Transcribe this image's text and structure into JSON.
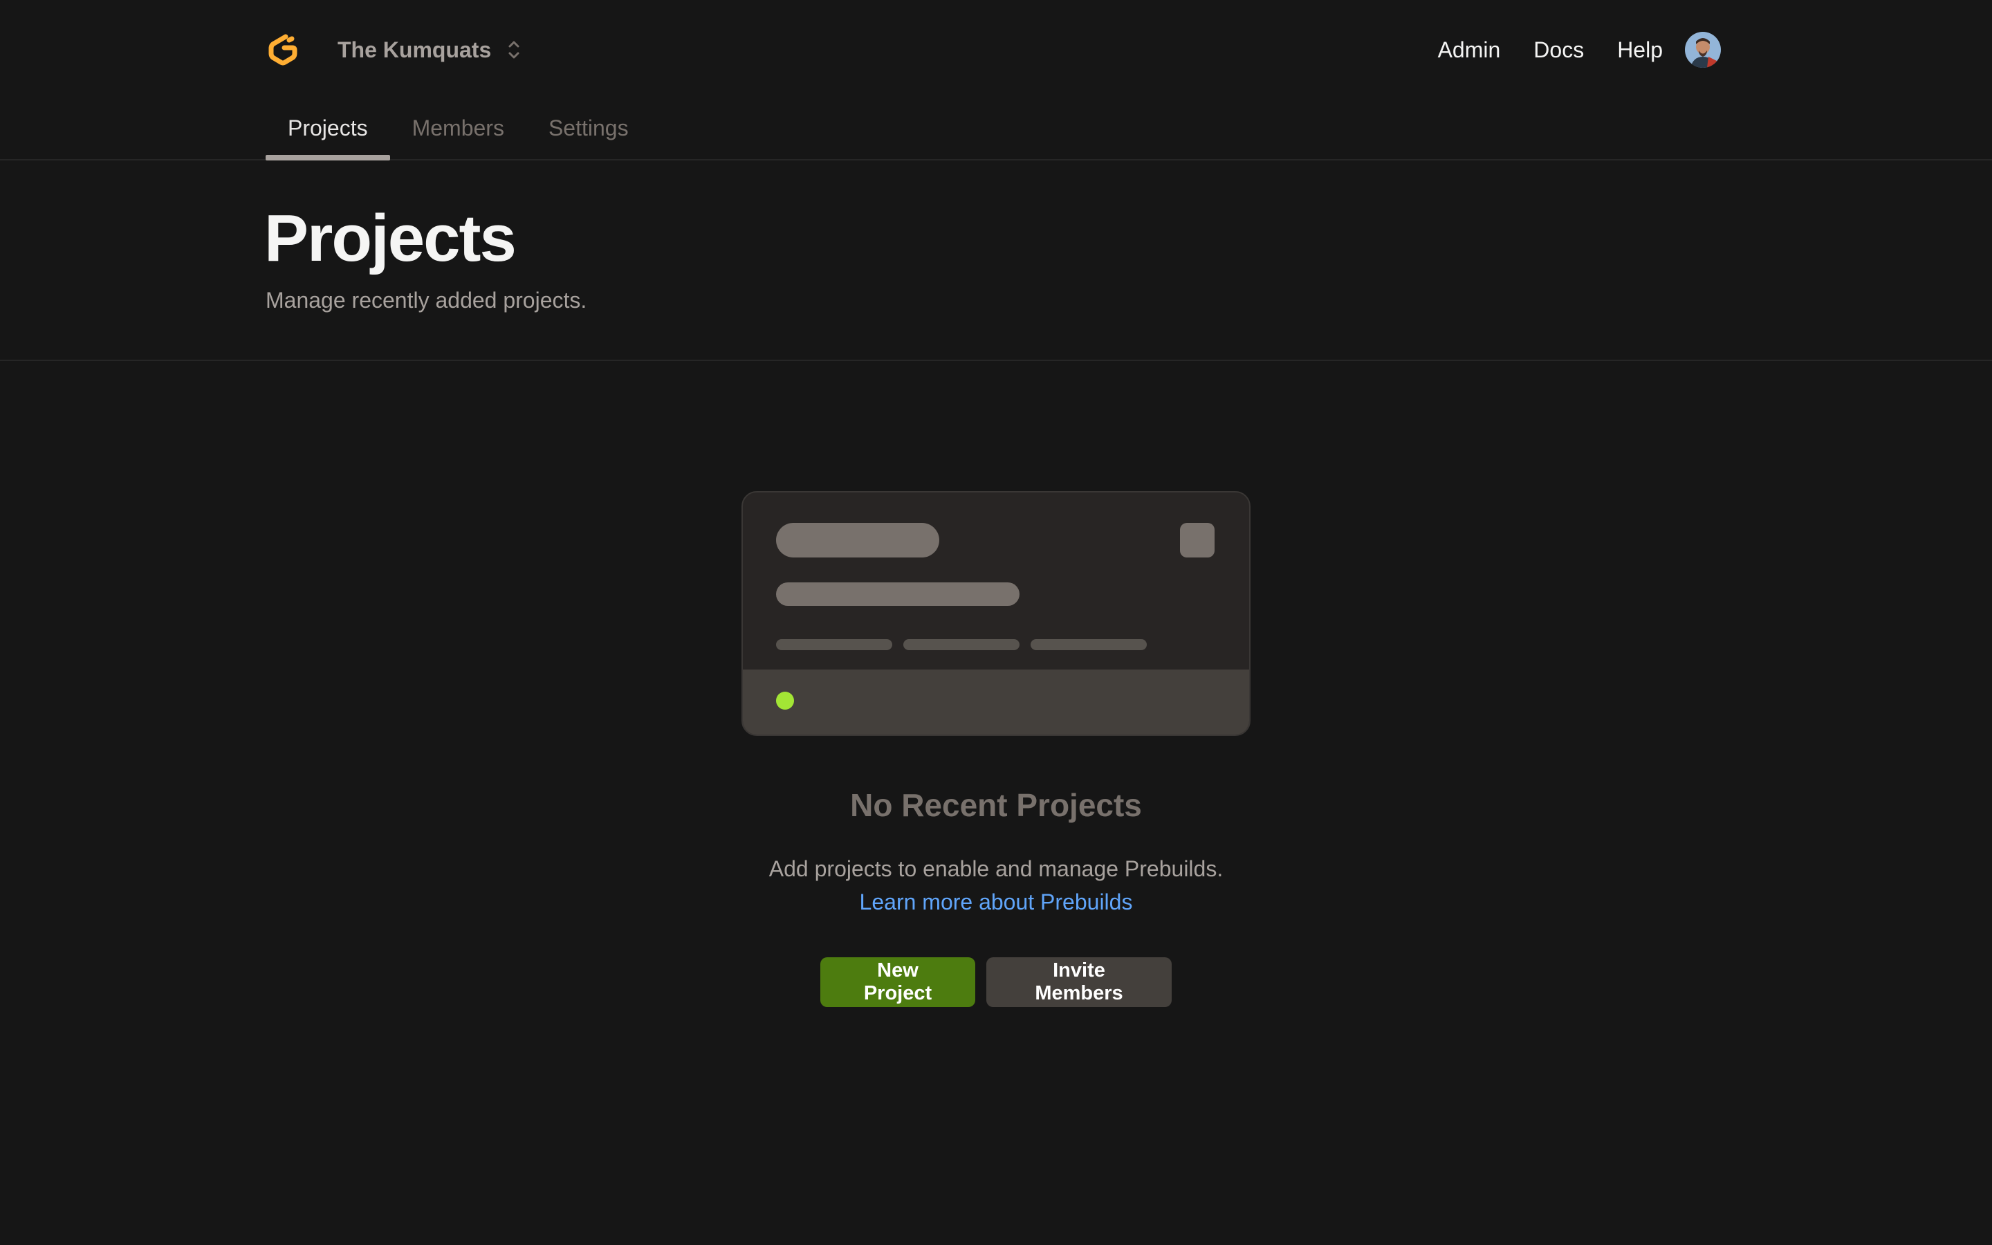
{
  "header": {
    "org_name": "The Kumquats",
    "logo_icon": "gitpod-logo-icon",
    "nav": {
      "admin": "Admin",
      "docs": "Docs",
      "help": "Help"
    },
    "avatar_icon": "user-avatar-icon"
  },
  "tabs": [
    {
      "label": "Projects",
      "active": true
    },
    {
      "label": "Members",
      "active": false
    },
    {
      "label": "Settings",
      "active": false
    }
  ],
  "page": {
    "title": "Projects",
    "subtitle": "Manage recently added projects."
  },
  "empty_state": {
    "title": "No Recent Projects",
    "description": "Add projects to enable and manage Prebuilds.",
    "link": "Learn more about Prebuilds",
    "primary_button": "New Project",
    "secondary_button": "Invite Members"
  },
  "colors": {
    "background": "#161616",
    "brand_orange": "#FFAE33",
    "primary_button": "#4d7c0f",
    "secondary_button": "#44403c",
    "link": "#60a5fa",
    "status_dot": "#a3e635"
  }
}
